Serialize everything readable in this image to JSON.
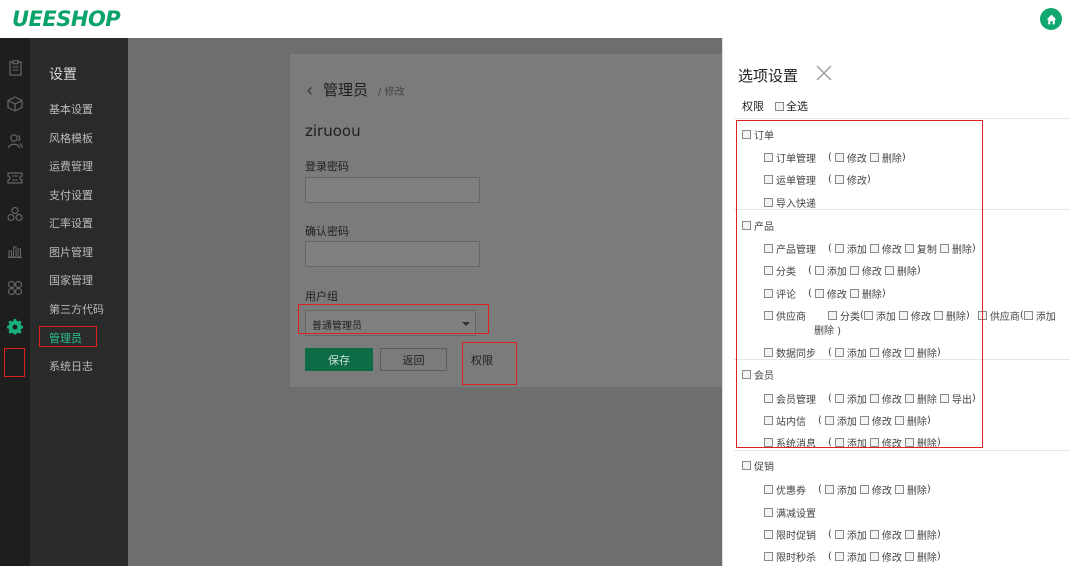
{
  "header": {
    "logo": "UEESHOP",
    "home_icon": "home-icon"
  },
  "rail_icons": [
    "clipboard-icon",
    "cube-icon",
    "users-icon",
    "ticket-icon",
    "layers-icon",
    "bar-chart-icon",
    "grid-icon",
    "gear-icon"
  ],
  "sidebar": {
    "title": "设置",
    "items": [
      {
        "label": "基本设置"
      },
      {
        "label": "风格模板"
      },
      {
        "label": "运费管理"
      },
      {
        "label": "支付设置"
      },
      {
        "label": "汇率设置"
      },
      {
        "label": "图片管理"
      },
      {
        "label": "国家管理"
      },
      {
        "label": "第三方代码"
      },
      {
        "label": "管理员"
      },
      {
        "label": "系统日志"
      }
    ],
    "active": "管理员"
  },
  "form": {
    "crumb_title": "管理员",
    "crumb_sub": "/ 修改",
    "username": "ziruoou",
    "login_pwd_label": "登录密码",
    "confirm_pwd_label": "确认密码",
    "group_label": "用户组",
    "group_value": "普通管理员",
    "save": "保存",
    "back": "返回",
    "perm": "权限"
  },
  "panel": {
    "title": "选项设置",
    "perm_label": "权限",
    "select_all": "全选",
    "groups": [
      {
        "name": "订单",
        "rows": [
          {
            "name": "订单管理",
            "actions": [
              "修改",
              "删除"
            ]
          },
          {
            "name": "运单管理",
            "actions": [
              "修改"
            ]
          },
          {
            "name": "导入快递",
            "actions": []
          }
        ]
      },
      {
        "name": "产品",
        "rows": [
          {
            "name": "产品管理",
            "actions": [
              "添加",
              "修改",
              "复制",
              "删除"
            ]
          },
          {
            "name": "分类",
            "actions": [
              "添加",
              "修改",
              "删除"
            ]
          },
          {
            "name": "评论",
            "actions": [
              "修改",
              "删除"
            ]
          },
          {
            "name": "供应商",
            "sub1": "分类",
            "actions": [
              "添加",
              "修改",
              "删除"
            ],
            "sub2": "供应商",
            "sub2_first": "添加",
            "wrap": "删除 )"
          },
          {
            "name": "数据同步",
            "actions": [
              "添加",
              "修改",
              "删除"
            ]
          }
        ]
      },
      {
        "name": "会员",
        "rows": [
          {
            "name": "会员管理",
            "actions": [
              "添加",
              "修改",
              "删除",
              "导出"
            ]
          },
          {
            "name": "站内信",
            "actions": [
              "添加",
              "修改",
              "删除"
            ]
          },
          {
            "name": "系统消息",
            "actions": [
              "添加",
              "修改",
              "删除"
            ]
          }
        ]
      },
      {
        "name": "促销",
        "rows": [
          {
            "name": "优惠券",
            "actions": [
              "添加",
              "修改",
              "删除"
            ]
          },
          {
            "name": "满减设置",
            "actions": []
          },
          {
            "name": "限时促销",
            "actions": [
              "添加",
              "修改",
              "删除"
            ]
          },
          {
            "name": "限时秒杀",
            "actions": [
              "添加",
              "修改",
              "删除"
            ]
          }
        ]
      }
    ]
  }
}
